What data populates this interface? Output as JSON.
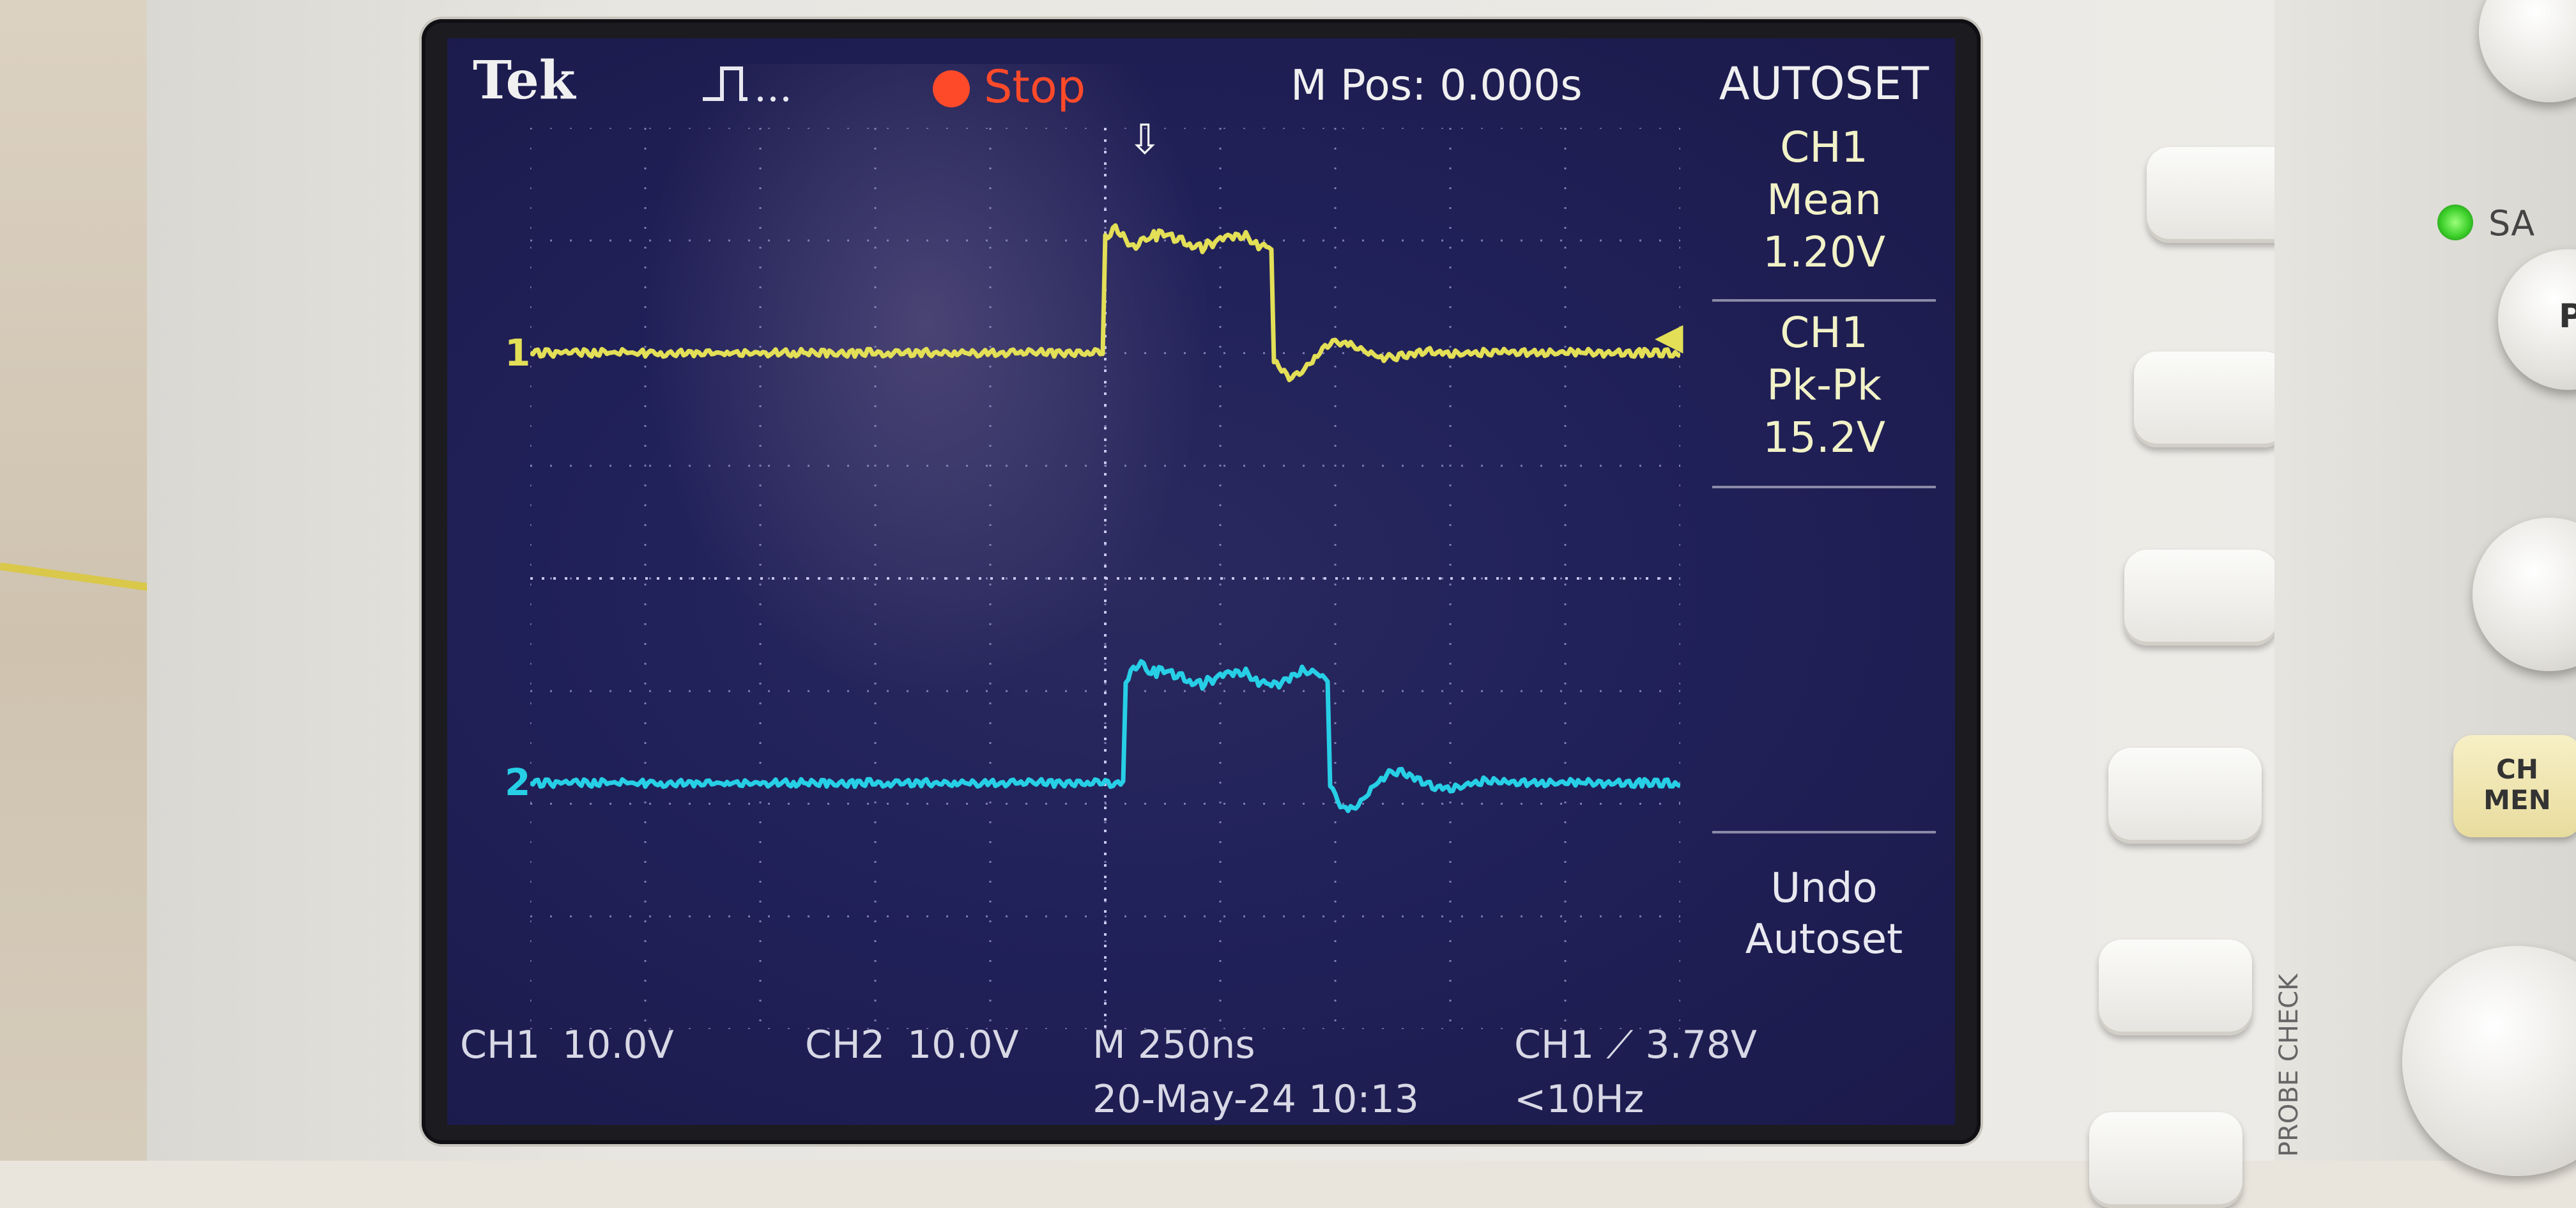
{
  "header": {
    "brand": "Tek",
    "run_state": "Stop",
    "horizontal_position": "M Pos: 0.000s"
  },
  "menu": {
    "title": "AUTOSET",
    "measurements": [
      {
        "source": "CH1",
        "type": "Mean",
        "value": "1.20V"
      },
      {
        "source": "CH1",
        "type": "Pk-Pk",
        "value": "15.2V"
      }
    ],
    "undo_line1": "Undo",
    "undo_line2": "Autoset"
  },
  "channels": {
    "ch1_marker": "1",
    "ch2_marker": "2",
    "ch1_color": "#e3df57",
    "ch2_color": "#27cfe6"
  },
  "footer": {
    "ch1_label": "CH1",
    "ch1_scale": "10.0V",
    "ch2_label": "CH2",
    "ch2_scale": "10.0V",
    "timebase": "M 250ns",
    "trigger": "CH1 ⟋ 3.78V",
    "date_time": "20-May-24 10:13",
    "trigger_freq": "<10Hz"
  },
  "panel": {
    "sa_label": "SA",
    "ch_menu_line1": "CH",
    "ch_menu_line2": "MEN",
    "probe_check": "PROBE CHECK",
    "side_p_label": "P"
  }
}
